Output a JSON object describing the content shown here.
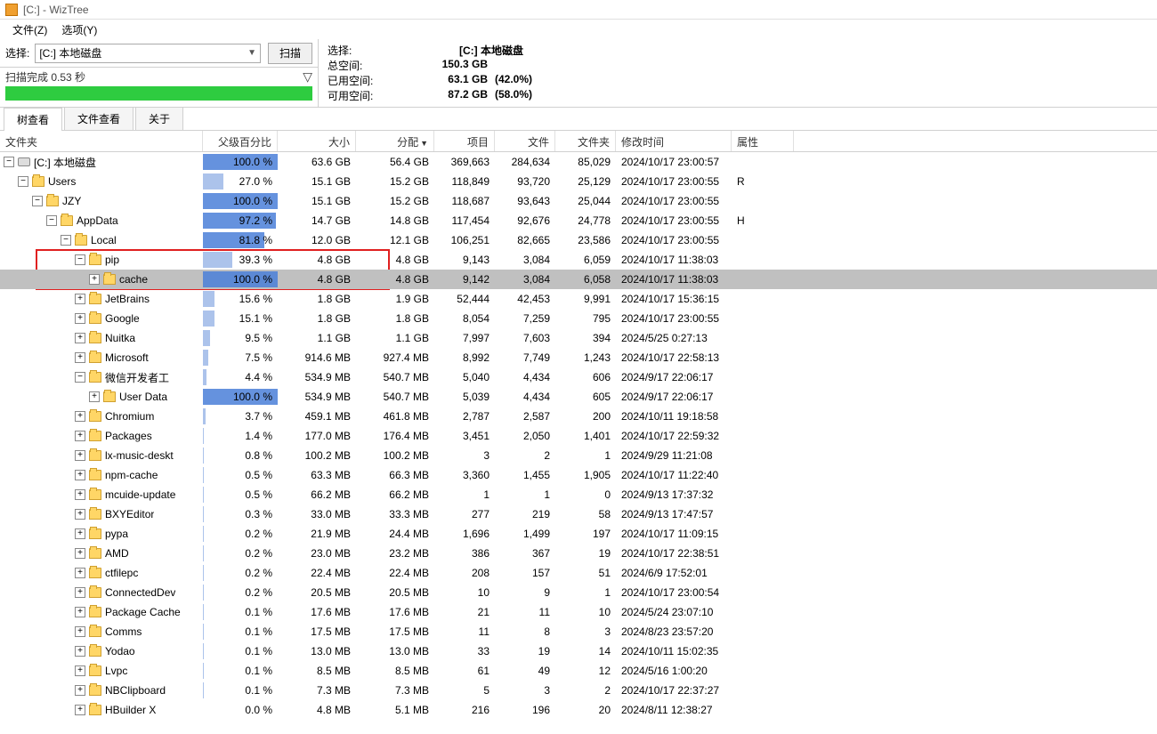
{
  "title": "[C:]  -  WizTree",
  "menus": {
    "file": "文件(Z)",
    "options": "选项(Y)"
  },
  "toolbar": {
    "select_label": "选择:",
    "drive_text": "[C:] 本地磁盘",
    "scan_btn": "扫描"
  },
  "status": {
    "scan_done": "扫描完成 0.53 秒",
    "progress_pct": 100
  },
  "info": {
    "select_label": "选择:",
    "select_val": "[C:]  本地磁盘",
    "total_label": "总空间:",
    "total_val": "150.3 GB",
    "used_label": "已用空间:",
    "used_val": "63.1 GB",
    "used_pct": "(42.0%)",
    "free_label": "可用空间:",
    "free_val": "87.2 GB",
    "free_pct": "(58.0%)"
  },
  "tabs": {
    "tree": "树查看",
    "file": "文件查看",
    "about": "关于"
  },
  "columns": {
    "folder": "文件夹",
    "pct": "父级百分比",
    "size": "大小",
    "alloc": "分配",
    "items": "项目",
    "files": "文件",
    "folders": "文件夹",
    "date": "修改时间",
    "attr": "属性"
  },
  "rows": [
    {
      "depth": 0,
      "exp": "-",
      "icon": "drive",
      "name": "[C:] 本地磁盘",
      "pct": "100.0 %",
      "bar": 100,
      "light": false,
      "size": "63.6 GB",
      "alloc": "56.4 GB",
      "items": "369,663",
      "files": "284,634",
      "folders": "85,029",
      "date": "2024/10/17 23:00:57",
      "attr": ""
    },
    {
      "depth": 1,
      "exp": "-",
      "icon": "folder",
      "name": "Users",
      "pct": "27.0 %",
      "bar": 27,
      "light": true,
      "size": "15.1 GB",
      "alloc": "15.2 GB",
      "items": "118,849",
      "files": "93,720",
      "folders": "25,129",
      "date": "2024/10/17 23:00:55",
      "attr": "R"
    },
    {
      "depth": 2,
      "exp": "-",
      "icon": "folder",
      "name": "JZY",
      "pct": "100.0 %",
      "bar": 100,
      "light": false,
      "size": "15.1 GB",
      "alloc": "15.2 GB",
      "items": "118,687",
      "files": "93,643",
      "folders": "25,044",
      "date": "2024/10/17 23:00:55",
      "attr": ""
    },
    {
      "depth": 3,
      "exp": "-",
      "icon": "folder",
      "name": "AppData",
      "pct": "97.2 %",
      "bar": 97.2,
      "light": false,
      "size": "14.7 GB",
      "alloc": "14.8 GB",
      "items": "117,454",
      "files": "92,676",
      "folders": "24,778",
      "date": "2024/10/17 23:00:55",
      "attr": "H"
    },
    {
      "depth": 4,
      "exp": "-",
      "icon": "folder",
      "name": "Local",
      "pct": "81.8 %",
      "bar": 81.8,
      "light": false,
      "size": "12.0 GB",
      "alloc": "12.1 GB",
      "items": "106,251",
      "files": "82,665",
      "folders": "23,586",
      "date": "2024/10/17 23:00:55",
      "attr": ""
    },
    {
      "depth": 5,
      "exp": "-",
      "icon": "folder",
      "name": "pip",
      "pct": "39.3 %",
      "bar": 39.3,
      "light": true,
      "size": "4.8 GB",
      "alloc": "4.8 GB",
      "items": "9,143",
      "files": "3,084",
      "folders": "6,059",
      "date": "2024/10/17 11:38:03",
      "attr": "",
      "redbox_top": true
    },
    {
      "depth": 6,
      "exp": "+",
      "icon": "folder",
      "name": "cache",
      "pct": "100.0 %",
      "bar": 100,
      "light": false,
      "size": "4.8 GB",
      "alloc": "4.8 GB",
      "items": "9,142",
      "files": "3,084",
      "folders": "6,058",
      "date": "2024/10/17 11:38:03",
      "attr": "",
      "selected": true,
      "redbox_bot": true
    },
    {
      "depth": 5,
      "exp": "+",
      "icon": "folder",
      "name": "JetBrains",
      "pct": "15.6 %",
      "bar": 15.6,
      "light": true,
      "size": "1.8 GB",
      "alloc": "1.9 GB",
      "items": "52,444",
      "files": "42,453",
      "folders": "9,991",
      "date": "2024/10/17 15:36:15",
      "attr": ""
    },
    {
      "depth": 5,
      "exp": "+",
      "icon": "folder",
      "name": "Google",
      "pct": "15.1 %",
      "bar": 15.1,
      "light": true,
      "size": "1.8 GB",
      "alloc": "1.8 GB",
      "items": "8,054",
      "files": "7,259",
      "folders": "795",
      "date": "2024/10/17 23:00:55",
      "attr": ""
    },
    {
      "depth": 5,
      "exp": "+",
      "icon": "folder",
      "name": "Nuitka",
      "pct": "9.5 %",
      "bar": 9.5,
      "light": true,
      "size": "1.1 GB",
      "alloc": "1.1 GB",
      "items": "7,997",
      "files": "7,603",
      "folders": "394",
      "date": "2024/5/25 0:27:13",
      "attr": ""
    },
    {
      "depth": 5,
      "exp": "+",
      "icon": "folder",
      "name": "Microsoft",
      "pct": "7.5 %",
      "bar": 7.5,
      "light": true,
      "size": "914.6 MB",
      "alloc": "927.4 MB",
      "items": "8,992",
      "files": "7,749",
      "folders": "1,243",
      "date": "2024/10/17 22:58:13",
      "attr": ""
    },
    {
      "depth": 5,
      "exp": "-",
      "icon": "folder",
      "name": "微信开发者工",
      "pct": "4.4 %",
      "bar": 4.4,
      "light": true,
      "size": "534.9 MB",
      "alloc": "540.7 MB",
      "items": "5,040",
      "files": "4,434",
      "folders": "606",
      "date": "2024/9/17 22:06:17",
      "attr": ""
    },
    {
      "depth": 6,
      "exp": "+",
      "icon": "folder",
      "name": "User Data",
      "pct": "100.0 %",
      "bar": 100,
      "light": false,
      "size": "534.9 MB",
      "alloc": "540.7 MB",
      "items": "5,039",
      "files": "4,434",
      "folders": "605",
      "date": "2024/9/17 22:06:17",
      "attr": ""
    },
    {
      "depth": 5,
      "exp": "+",
      "icon": "folder",
      "name": "Chromium",
      "pct": "3.7 %",
      "bar": 3.7,
      "light": true,
      "size": "459.1 MB",
      "alloc": "461.8 MB",
      "items": "2,787",
      "files": "2,587",
      "folders": "200",
      "date": "2024/10/11 19:18:58",
      "attr": ""
    },
    {
      "depth": 5,
      "exp": "+",
      "icon": "folder",
      "name": "Packages",
      "pct": "1.4 %",
      "bar": 1.4,
      "light": true,
      "size": "177.0 MB",
      "alloc": "176.4 MB",
      "items": "3,451",
      "files": "2,050",
      "folders": "1,401",
      "date": "2024/10/17 22:59:32",
      "attr": ""
    },
    {
      "depth": 5,
      "exp": "+",
      "icon": "folder",
      "name": "lx-music-deskt",
      "pct": "0.8 %",
      "bar": 0.8,
      "light": true,
      "size": "100.2 MB",
      "alloc": "100.2 MB",
      "items": "3",
      "files": "2",
      "folders": "1",
      "date": "2024/9/29 11:21:08",
      "attr": ""
    },
    {
      "depth": 5,
      "exp": "+",
      "icon": "folder",
      "name": "npm-cache",
      "pct": "0.5 %",
      "bar": 0.5,
      "light": true,
      "size": "63.3 MB",
      "alloc": "66.3 MB",
      "items": "3,360",
      "files": "1,455",
      "folders": "1,905",
      "date": "2024/10/17 11:22:40",
      "attr": ""
    },
    {
      "depth": 5,
      "exp": "+",
      "icon": "folder",
      "name": "mcuide-update",
      "pct": "0.5 %",
      "bar": 0.5,
      "light": true,
      "size": "66.2 MB",
      "alloc": "66.2 MB",
      "items": "1",
      "files": "1",
      "folders": "0",
      "date": "2024/9/13 17:37:32",
      "attr": ""
    },
    {
      "depth": 5,
      "exp": "+",
      "icon": "folder",
      "name": "BXYEditor",
      "pct": "0.3 %",
      "bar": 0.3,
      "light": true,
      "size": "33.0 MB",
      "alloc": "33.3 MB",
      "items": "277",
      "files": "219",
      "folders": "58",
      "date": "2024/9/13 17:47:57",
      "attr": ""
    },
    {
      "depth": 5,
      "exp": "+",
      "icon": "folder",
      "name": "pypa",
      "pct": "0.2 %",
      "bar": 0.2,
      "light": true,
      "size": "21.9 MB",
      "alloc": "24.4 MB",
      "items": "1,696",
      "files": "1,499",
      "folders": "197",
      "date": "2024/10/17 11:09:15",
      "attr": ""
    },
    {
      "depth": 5,
      "exp": "+",
      "icon": "folder",
      "name": "AMD",
      "pct": "0.2 %",
      "bar": 0.2,
      "light": true,
      "size": "23.0 MB",
      "alloc": "23.2 MB",
      "items": "386",
      "files": "367",
      "folders": "19",
      "date": "2024/10/17 22:38:51",
      "attr": ""
    },
    {
      "depth": 5,
      "exp": "+",
      "icon": "folder",
      "name": "ctfilepc",
      "pct": "0.2 %",
      "bar": 0.2,
      "light": true,
      "size": "22.4 MB",
      "alloc": "22.4 MB",
      "items": "208",
      "files": "157",
      "folders": "51",
      "date": "2024/6/9 17:52:01",
      "attr": ""
    },
    {
      "depth": 5,
      "exp": "+",
      "icon": "folder",
      "name": "ConnectedDev",
      "pct": "0.2 %",
      "bar": 0.2,
      "light": true,
      "size": "20.5 MB",
      "alloc": "20.5 MB",
      "items": "10",
      "files": "9",
      "folders": "1",
      "date": "2024/10/17 23:00:54",
      "attr": ""
    },
    {
      "depth": 5,
      "exp": "+",
      "icon": "folder",
      "name": "Package Cache",
      "pct": "0.1 %",
      "bar": 0.1,
      "light": true,
      "size": "17.6 MB",
      "alloc": "17.6 MB",
      "items": "21",
      "files": "11",
      "folders": "10",
      "date": "2024/5/24 23:07:10",
      "attr": ""
    },
    {
      "depth": 5,
      "exp": "+",
      "icon": "folder",
      "name": "Comms",
      "pct": "0.1 %",
      "bar": 0.1,
      "light": true,
      "size": "17.5 MB",
      "alloc": "17.5 MB",
      "items": "11",
      "files": "8",
      "folders": "3",
      "date": "2024/8/23 23:57:20",
      "attr": ""
    },
    {
      "depth": 5,
      "exp": "+",
      "icon": "folder",
      "name": "Yodao",
      "pct": "0.1 %",
      "bar": 0.1,
      "light": true,
      "size": "13.0 MB",
      "alloc": "13.0 MB",
      "items": "33",
      "files": "19",
      "folders": "14",
      "date": "2024/10/11 15:02:35",
      "attr": ""
    },
    {
      "depth": 5,
      "exp": "+",
      "icon": "folder",
      "name": "Lvpc",
      "pct": "0.1 %",
      "bar": 0.1,
      "light": true,
      "size": "8.5 MB",
      "alloc": "8.5 MB",
      "items": "61",
      "files": "49",
      "folders": "12",
      "date": "2024/5/16 1:00:20",
      "attr": ""
    },
    {
      "depth": 5,
      "exp": "+",
      "icon": "folder",
      "name": "NBClipboard",
      "pct": "0.1 %",
      "bar": 0.1,
      "light": true,
      "size": "7.3 MB",
      "alloc": "7.3 MB",
      "items": "5",
      "files": "3",
      "folders": "2",
      "date": "2024/10/17 22:37:27",
      "attr": ""
    },
    {
      "depth": 5,
      "exp": "+",
      "icon": "folder",
      "name": "HBuilder X",
      "pct": "0.0 %",
      "bar": 0,
      "light": true,
      "size": "4.8 MB",
      "alloc": "5.1 MB",
      "items": "216",
      "files": "196",
      "folders": "20",
      "date": "2024/8/11 12:38:27",
      "attr": ""
    }
  ]
}
